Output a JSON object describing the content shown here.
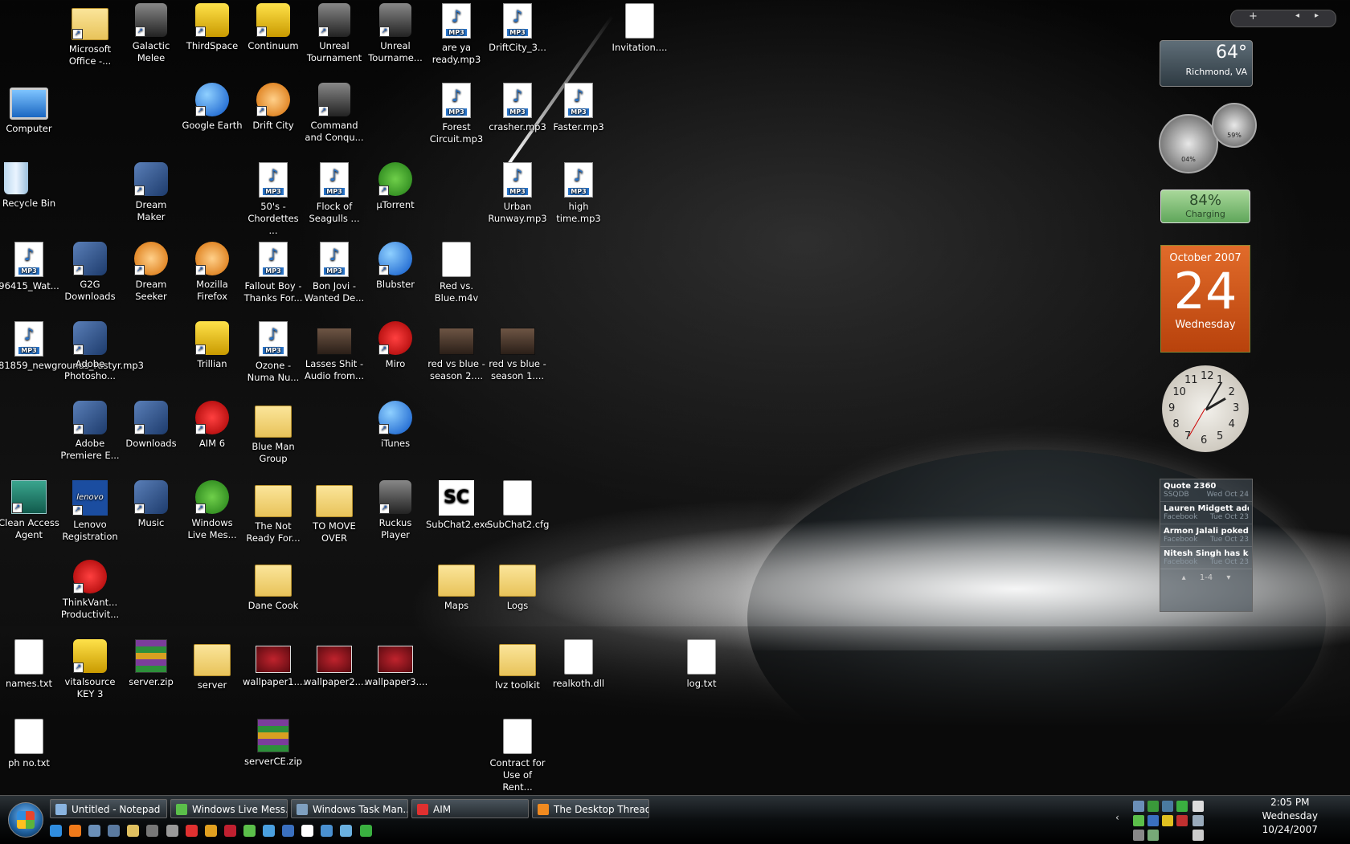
{
  "desktop": {
    "icons": [
      {
        "label": "Microsoft Office -...",
        "type": "folder",
        "shortcut": true,
        "col": 1,
        "row": 0
      },
      {
        "label": "Galactic Melee",
        "type": "dark",
        "shortcut": true,
        "col": 2,
        "row": 0
      },
      {
        "label": "ThirdSpace",
        "type": "yellow",
        "shortcut": true,
        "col": 3,
        "row": 0
      },
      {
        "label": "Continuum",
        "type": "yellow",
        "shortcut": true,
        "col": 4,
        "row": 0
      },
      {
        "label": "Unreal Tournament",
        "type": "dark",
        "shortcut": true,
        "col": 5,
        "row": 0
      },
      {
        "label": "Unreal Tourname...",
        "type": "dark",
        "shortcut": true,
        "col": 6,
        "row": 0
      },
      {
        "label": "are ya ready.mp3",
        "type": "mp3",
        "shortcut": false,
        "col": 7,
        "row": 0
      },
      {
        "label": "DriftCity_3...",
        "type": "mp3",
        "shortcut": false,
        "col": 8,
        "row": 0
      },
      {
        "label": "Invitation....",
        "type": "file",
        "shortcut": false,
        "col": 10,
        "row": 0
      },
      {
        "label": "Computer",
        "type": "pc",
        "shortcut": false,
        "col": 0,
        "row": 1
      },
      {
        "label": "Google Earth",
        "type": "blue",
        "shortcut": true,
        "col": 3,
        "row": 1
      },
      {
        "label": "Drift City",
        "type": "orange",
        "shortcut": true,
        "col": 4,
        "row": 1
      },
      {
        "label": "Command and Conqu...",
        "type": "dark",
        "shortcut": true,
        "col": 5,
        "row": 1
      },
      {
        "label": "Forest Circuit.mp3",
        "type": "mp3",
        "shortcut": false,
        "col": 7,
        "row": 1
      },
      {
        "label": "crasher.mp3",
        "type": "mp3",
        "shortcut": false,
        "col": 8,
        "row": 1
      },
      {
        "label": "Faster.mp3",
        "type": "mp3",
        "shortcut": false,
        "col": 9,
        "row": 1
      },
      {
        "label": "Recycle Bin",
        "type": "bin",
        "shortcut": false,
        "col": 0,
        "row": 2
      },
      {
        "label": "Dream Maker",
        "type": "app",
        "shortcut": true,
        "col": 2,
        "row": 2
      },
      {
        "label": "50's - Chordettes ...",
        "type": "mp3",
        "shortcut": false,
        "col": 4,
        "row": 2
      },
      {
        "label": "Flock of Seagulls ...",
        "type": "mp3",
        "shortcut": false,
        "col": 5,
        "row": 2
      },
      {
        "label": "µTorrent",
        "type": "green",
        "shortcut": true,
        "col": 6,
        "row": 2
      },
      {
        "label": "Urban Runway.mp3",
        "type": "mp3",
        "shortcut": false,
        "col": 8,
        "row": 2
      },
      {
        "label": "high time.mp3",
        "type": "mp3",
        "shortcut": false,
        "col": 9,
        "row": 2
      },
      {
        "label": "96415_Wat...",
        "type": "mp3",
        "shortcut": false,
        "col": 0,
        "row": 3
      },
      {
        "label": "G2G Downloads",
        "type": "app",
        "shortcut": true,
        "col": 1,
        "row": 3
      },
      {
        "label": "Dream Seeker",
        "type": "orange",
        "shortcut": true,
        "col": 2,
        "row": 3
      },
      {
        "label": "Mozilla Firefox",
        "type": "orange",
        "shortcut": true,
        "col": 3,
        "row": 3
      },
      {
        "label": "Fallout Boy - Thanks For...",
        "type": "mp3",
        "shortcut": false,
        "col": 4,
        "row": 3
      },
      {
        "label": "Bon Jovi - Wanted De...",
        "type": "mp3",
        "shortcut": false,
        "col": 5,
        "row": 3
      },
      {
        "label": "Blubster",
        "type": "blue",
        "shortcut": true,
        "col": 6,
        "row": 3
      },
      {
        "label": "Red vs. Blue.m4v",
        "type": "file",
        "shortcut": false,
        "col": 7,
        "row": 3
      },
      {
        "label": "81859_newgrounds_rustyr.mp3",
        "type": "mp3",
        "shortcut": false,
        "col": 0,
        "row": 4
      },
      {
        "label": "Adobe Photosho...",
        "type": "app",
        "shortcut": true,
        "col": 1,
        "row": 4
      },
      {
        "label": "Trillian",
        "type": "yellow",
        "shortcut": true,
        "col": 3,
        "row": 4
      },
      {
        "label": "Ozone - Numa Nu...",
        "type": "mp3",
        "shortcut": false,
        "col": 4,
        "row": 4
      },
      {
        "label": "Lasses Shit - Audio from...",
        "type": "video",
        "shortcut": false,
        "col": 5,
        "row": 4
      },
      {
        "label": "Miro",
        "type": "red",
        "shortcut": true,
        "col": 6,
        "row": 4
      },
      {
        "label": "red vs blue - season 2....",
        "type": "video",
        "shortcut": false,
        "col": 7,
        "row": 4
      },
      {
        "label": "red vs blue - season 1....",
        "type": "video",
        "shortcut": false,
        "col": 8,
        "row": 4
      },
      {
        "label": "Adobe Premiere E...",
        "type": "app",
        "shortcut": true,
        "col": 1,
        "row": 5
      },
      {
        "label": "Downloads",
        "type": "app",
        "shortcut": true,
        "col": 2,
        "row": 5
      },
      {
        "label": "AIM 6",
        "type": "red",
        "shortcut": true,
        "col": 3,
        "row": 5
      },
      {
        "label": "Blue Man Group",
        "type": "folder",
        "shortcut": false,
        "col": 4,
        "row": 5
      },
      {
        "label": "iTunes",
        "type": "blue",
        "shortcut": true,
        "col": 6,
        "row": 5
      },
      {
        "label": "Clean Access Agent",
        "type": "teal",
        "shortcut": true,
        "col": 0,
        "row": 6
      },
      {
        "label": "Lenovo Registration",
        "type": "lenovo",
        "shortcut": true,
        "col": 1,
        "row": 6
      },
      {
        "label": "Music",
        "type": "app",
        "shortcut": true,
        "col": 2,
        "row": 6
      },
      {
        "label": "Windows Live Mes...",
        "type": "green",
        "shortcut": true,
        "col": 3,
        "row": 6
      },
      {
        "label": "The Not Ready For...",
        "type": "folder",
        "shortcut": false,
        "col": 4,
        "row": 6
      },
      {
        "label": "TO MOVE OVER",
        "type": "folder",
        "shortcut": false,
        "col": 5,
        "row": 6
      },
      {
        "label": "Ruckus Player",
        "type": "dark",
        "shortcut": true,
        "col": 6,
        "row": 6
      },
      {
        "label": "SubChat2.exe",
        "type": "black",
        "shortcut": false,
        "col": 7,
        "row": 6
      },
      {
        "label": "SubChat2.cfg",
        "type": "file",
        "shortcut": false,
        "col": 8,
        "row": 6
      },
      {
        "label": "ThinkVant... Productivit...",
        "type": "red",
        "shortcut": true,
        "col": 1,
        "row": 7
      },
      {
        "label": "Dane Cook",
        "type": "folder",
        "shortcut": false,
        "col": 4,
        "row": 7
      },
      {
        "label": "Maps",
        "type": "folder",
        "shortcut": false,
        "col": 7,
        "row": 7
      },
      {
        "label": "Logs",
        "type": "folder",
        "shortcut": false,
        "col": 8,
        "row": 7
      },
      {
        "label": "names.txt",
        "type": "file",
        "shortcut": false,
        "col": 0,
        "row": 8
      },
      {
        "label": "vitalsource KEY 3",
        "type": "yellow",
        "shortcut": true,
        "col": 1,
        "row": 8
      },
      {
        "label": "server.zip",
        "type": "zip",
        "shortcut": false,
        "col": 2,
        "row": 8
      },
      {
        "label": "server",
        "type": "folder",
        "shortcut": false,
        "col": 3,
        "row": 8
      },
      {
        "label": "wallpaper1....",
        "type": "wall",
        "shortcut": false,
        "col": 4,
        "row": 8
      },
      {
        "label": "wallpaper2....",
        "type": "wall",
        "shortcut": false,
        "col": 5,
        "row": 8
      },
      {
        "label": "wallpaper3....",
        "type": "wall",
        "shortcut": false,
        "col": 6,
        "row": 8
      },
      {
        "label": "lvz toolkit",
        "type": "folder",
        "shortcut": false,
        "col": 8,
        "row": 8
      },
      {
        "label": "realkoth.dll",
        "type": "file",
        "shortcut": false,
        "col": 9,
        "row": 8
      },
      {
        "label": "log.txt",
        "type": "file",
        "shortcut": false,
        "col": 11,
        "row": 8
      },
      {
        "label": "ph no.txt",
        "type": "file",
        "shortcut": false,
        "col": 0,
        "row": 9
      },
      {
        "label": "serverCE.zip",
        "type": "zip",
        "shortcut": false,
        "col": 4,
        "row": 9
      },
      {
        "label": "Contract for Use of Rent...",
        "type": "file",
        "shortcut": false,
        "col": 8,
        "row": 9
      }
    ]
  },
  "sidebar": {
    "add_button": "+",
    "weather": {
      "temp": "64°",
      "city": "Richmond, VA"
    },
    "meters": {
      "cpu": "04%",
      "ram": "59%"
    },
    "battery": {
      "percent": "84%",
      "status": "Charging"
    },
    "calendar": {
      "month": "October 2007",
      "day": "24",
      "weekday": "Wednesday"
    },
    "clock": {
      "numbers": [
        "12",
        "1",
        "2",
        "3",
        "4",
        "5",
        "6",
        "7",
        "8",
        "9",
        "10",
        "11"
      ]
    },
    "feed": {
      "items": [
        {
          "title": "Quote 2360",
          "source": "SSQDB",
          "date": "Wed Oct 24"
        },
        {
          "title": "Lauren Midgett  add...",
          "source": "Facebook",
          "date": "Tue Oct 23"
        },
        {
          "title": "Armon Jalali poked y...",
          "source": "Facebook",
          "date": "Tue Oct 23"
        },
        {
          "title": "Nitesh Singh  has kar...",
          "source": "Facebook",
          "date": "Tue Oct 23"
        }
      ],
      "page": "1-4"
    }
  },
  "taskbar": {
    "tasks": [
      {
        "label": "Untitled - Notepad",
        "color": "#8ab4e0"
      },
      {
        "label": "Windows Live Mess...",
        "color": "#5bbf4a"
      },
      {
        "label": "Windows Task Man...",
        "color": "#7fa0c0"
      },
      {
        "label": "AIM",
        "color": "#e03030"
      },
      {
        "label": "The Desktop Thread...",
        "color": "#f08a20"
      }
    ],
    "clock": {
      "time": "2:05 PM",
      "day": "Wednesday",
      "date": "10/24/2007"
    }
  }
}
